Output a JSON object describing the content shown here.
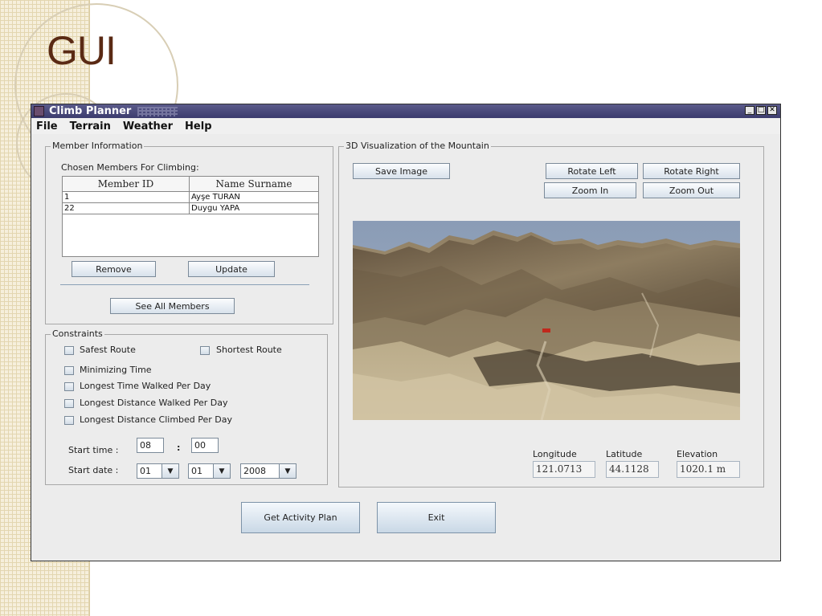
{
  "slide": {
    "title": "GUI"
  },
  "window": {
    "title": "Climb Planner",
    "controls": [
      "minimize-icon",
      "maximize-icon",
      "close-icon"
    ]
  },
  "menu": [
    "File",
    "Terrain",
    "Weather",
    "Help"
  ],
  "member_info": {
    "group_title": "Member Information",
    "chosen_label": "Chosen Members For Climbing:",
    "columns": [
      "Member ID",
      "Name Surname"
    ],
    "rows": [
      {
        "id": "1",
        "name": "Ayşe TURAN"
      },
      {
        "id": "22",
        "name": "Duygu YAPA"
      }
    ],
    "remove_label": "Remove",
    "update_label": "Update",
    "see_all_label": "See All Members"
  },
  "constraints": {
    "group_title": "Constraints",
    "options": {
      "safest": "Safest Route",
      "shortest": "Shortest Route",
      "min_time": "Minimizing Time",
      "longest_time": "Longest Time Walked Per Day",
      "longest_distance": "Longest Distance Walked Per Day",
      "longest_climbed": "Longest Distance Climbed Per Day"
    },
    "start_time_label": "Start time :",
    "hour": "08",
    "time_sep": ":",
    "minute": "00",
    "start_date_label": "Start date :",
    "day": "01",
    "month": "01",
    "year": "2008"
  },
  "visualization": {
    "group_title": "3D Visualization of the Mountain",
    "save_image_label": "Save Image",
    "rotate_left_label": "Rotate Left",
    "rotate_right_label": "Rotate Right",
    "zoom_in_label": "Zoom In",
    "zoom_out_label": "Zoom Out",
    "longitude_label": "Longitude",
    "latitude_label": "Latitude",
    "elevation_label": "Elevation",
    "longitude": "121.0713",
    "latitude": "44.1128",
    "elevation": "1020.1 m"
  },
  "actions": {
    "get_plan_label": "Get Activity Plan",
    "exit_label": "Exit"
  },
  "colors": {
    "title_bar": "#3c3c6e",
    "slide_title": "#5a2a14",
    "button_gradient_end": "#d8e2ec"
  }
}
